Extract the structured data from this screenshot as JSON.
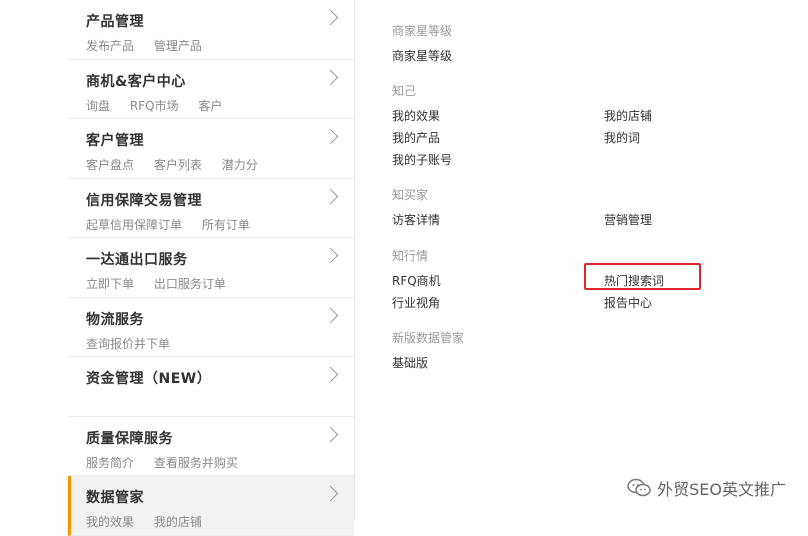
{
  "left_menu": {
    "items": [
      {
        "title": "产品管理",
        "subs": [
          "发布产品",
          "管理产品"
        ]
      },
      {
        "title": "商机&客户中心",
        "subs": [
          "询盘",
          "RFQ市场",
          "客户"
        ]
      },
      {
        "title": "客户管理",
        "subs": [
          "客户盘点",
          "客户列表",
          "潜力分"
        ]
      },
      {
        "title": "信用保障交易管理",
        "subs": [
          "起草信用保障订单",
          "所有订单"
        ]
      },
      {
        "title": "一达通出口服务",
        "subs": [
          "立即下单",
          "出口服务订单"
        ]
      },
      {
        "title": "物流服务",
        "subs": [
          "查询报价并下单"
        ]
      },
      {
        "title": "资金管理（NEW）",
        "subs": []
      },
      {
        "title": "质量保障服务",
        "subs": [
          "服务简介",
          "查看服务并购买"
        ]
      },
      {
        "title": "数据管家",
        "subs": [
          "我的效果",
          "我的店铺"
        ]
      }
    ],
    "active_index": 8,
    "active_color": "#f39800"
  },
  "right_panel": {
    "sections": [
      {
        "title": "商家星等级",
        "links": [
          "商家星等级"
        ]
      },
      {
        "title": "知己",
        "links": [
          "我的效果",
          "我的店铺",
          "我的产品",
          "我的词",
          "我的子账号"
        ]
      },
      {
        "title": "知买家",
        "links": [
          "访客详情",
          "营销管理"
        ]
      },
      {
        "title": "知行情",
        "links": [
          "RFQ商机",
          "热门搜索词",
          "行业视角",
          "报告中心"
        ]
      },
      {
        "title": "新版数据管家",
        "links": [
          "基础版"
        ]
      }
    ],
    "highlighted_link": "热门搜索词",
    "highlight_color": "#e3262b"
  },
  "watermark": {
    "text": "外贸SEO英文推广",
    "icon": "wechat-icon"
  }
}
